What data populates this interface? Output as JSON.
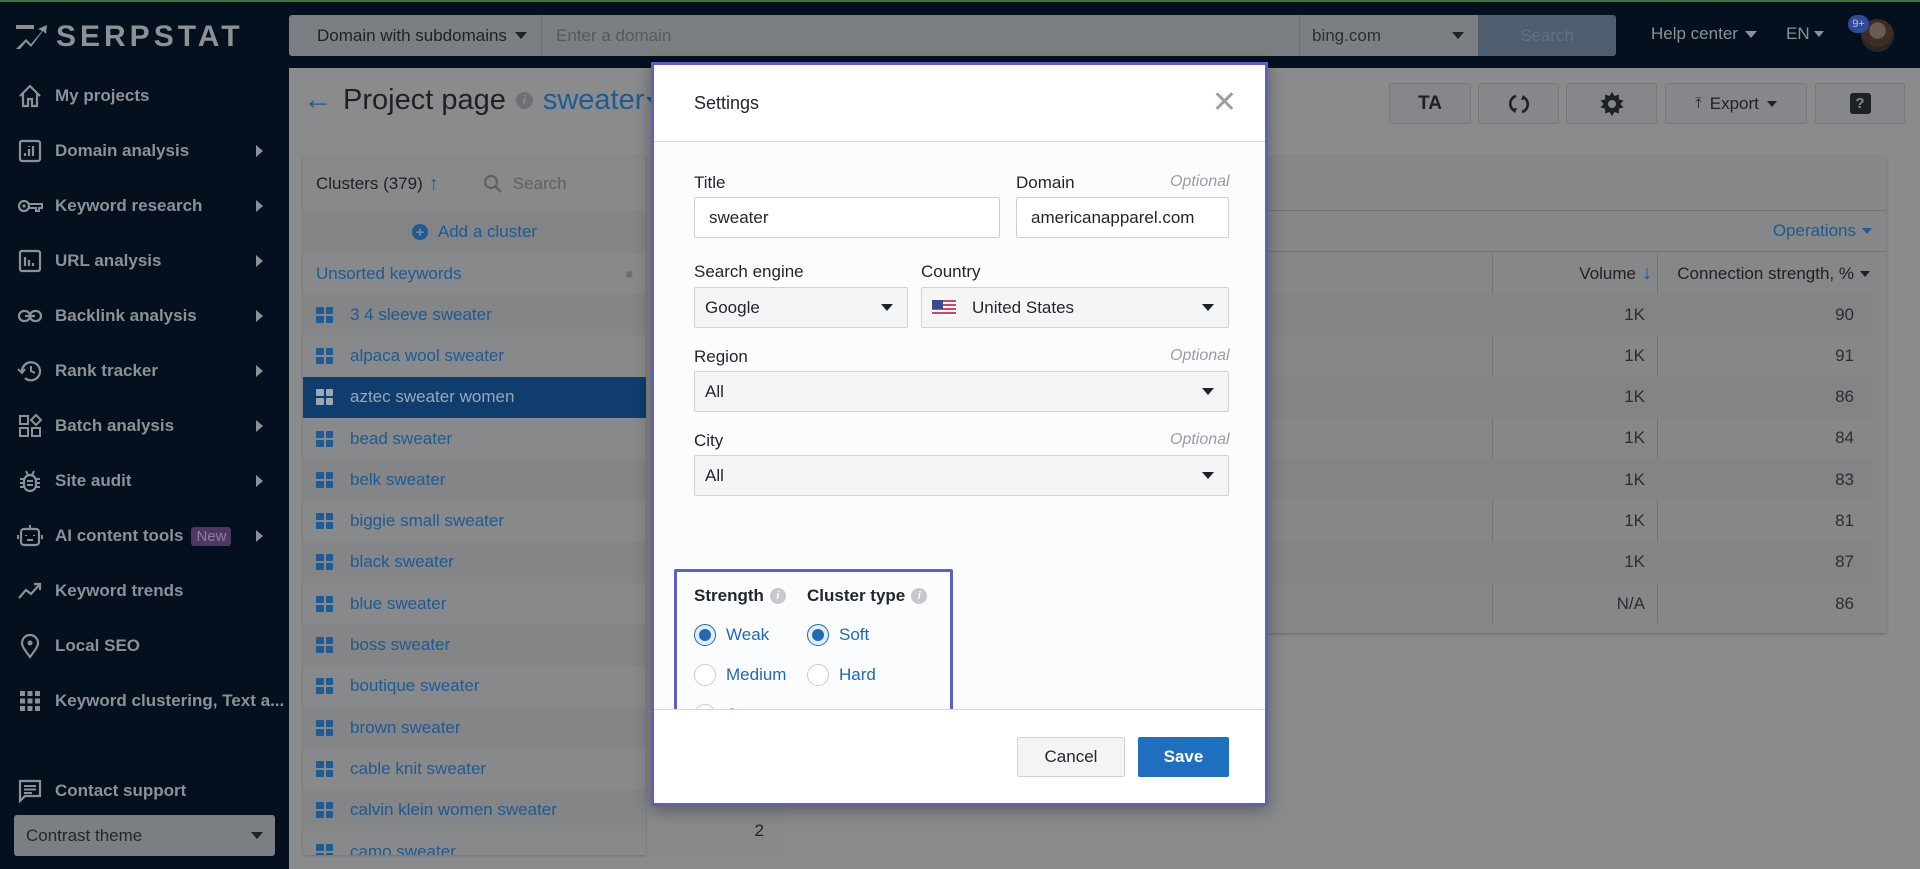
{
  "topbar": {
    "logo_text": "SERPSTAT",
    "search_type": "Domain with subdomains",
    "domain_placeholder": "Enter a domain",
    "database": "bing.com",
    "search_button": "Search",
    "help_center": "Help center",
    "language": "EN",
    "notifications_badge": "9+"
  },
  "sidebar": {
    "items": [
      {
        "label": "My projects",
        "icon": "home-icon",
        "has_submenu": false
      },
      {
        "label": "Domain analysis",
        "icon": "domain-analysis-icon",
        "has_submenu": true
      },
      {
        "label": "Keyword research",
        "icon": "key-icon",
        "has_submenu": true
      },
      {
        "label": "URL analysis",
        "icon": "url-analysis-icon",
        "has_submenu": true
      },
      {
        "label": "Backlink analysis",
        "icon": "link-icon",
        "has_submenu": true
      },
      {
        "label": "Rank tracker",
        "icon": "history-icon",
        "has_submenu": true
      },
      {
        "label": "Batch analysis",
        "icon": "batch-icon",
        "has_submenu": true
      },
      {
        "label": "Site audit",
        "icon": "bug-icon",
        "has_submenu": true
      },
      {
        "label": "AI content tools",
        "icon": "robot-icon",
        "has_submenu": true,
        "badge": "New"
      },
      {
        "label": "Keyword trends",
        "icon": "trend-icon",
        "has_submenu": false
      },
      {
        "label": "Local SEO",
        "icon": "location-pin-icon",
        "has_submenu": false
      },
      {
        "label": "Keyword clustering, Text a...",
        "icon": "grid-icon",
        "has_submenu": false
      }
    ],
    "contact_support": "Contact support",
    "theme_select": "Contrast theme"
  },
  "page": {
    "title": "Project page",
    "project_name": "sweater",
    "toolbar": {
      "ta_label": "TA",
      "export_label": "Export",
      "help_label": "?"
    }
  },
  "clusters": {
    "header": "Clusters (379)",
    "search_placeholder": "Search",
    "add_cluster": "Add a cluster",
    "unsorted": "Unsorted keywords",
    "items": [
      "3 4 sleeve sweater",
      "alpaca wool sweater",
      "aztec sweater women",
      "bead sweater",
      "belk sweater",
      "biggie small sweater",
      "black sweater",
      "blue sweater",
      "boss sweater",
      "boutique sweater",
      "brown sweater",
      "cable knit sweater",
      "calvin klein women sweater",
      "camo sweater"
    ],
    "active_index": 2,
    "last_count": "2"
  },
  "table": {
    "operations": "Operations",
    "columns": [
      "Volume",
      "Connection strength, %"
    ],
    "rows": [
      {
        "volume": "1K",
        "strength": "90"
      },
      {
        "volume": "1K",
        "strength": "91"
      },
      {
        "volume": "1K",
        "strength": "86"
      },
      {
        "volume": "1K",
        "strength": "84"
      },
      {
        "volume": "1K",
        "strength": "83"
      },
      {
        "volume": "1K",
        "strength": "81"
      },
      {
        "volume": "1K",
        "strength": "87"
      },
      {
        "volume": "N/A",
        "strength": "86"
      }
    ]
  },
  "modal": {
    "title": "Settings",
    "optional": "Optional",
    "title_label": "Title",
    "title_value": "sweater",
    "domain_label": "Domain",
    "domain_value": "americanapparel.com",
    "engine_label": "Search engine",
    "engine_value": "Google",
    "country_label": "Country",
    "country_value": "United States",
    "region_label": "Region",
    "region_value": "All",
    "city_label": "City",
    "city_value": "All",
    "strength_label": "Strength",
    "strength_options": [
      "Weak",
      "Medium",
      "Strong"
    ],
    "strength_selected": "Weak",
    "cluster_type_label": "Cluster type",
    "cluster_type_options": [
      "Soft",
      "Hard"
    ],
    "cluster_type_selected": "Soft",
    "cancel": "Cancel",
    "save": "Save"
  }
}
